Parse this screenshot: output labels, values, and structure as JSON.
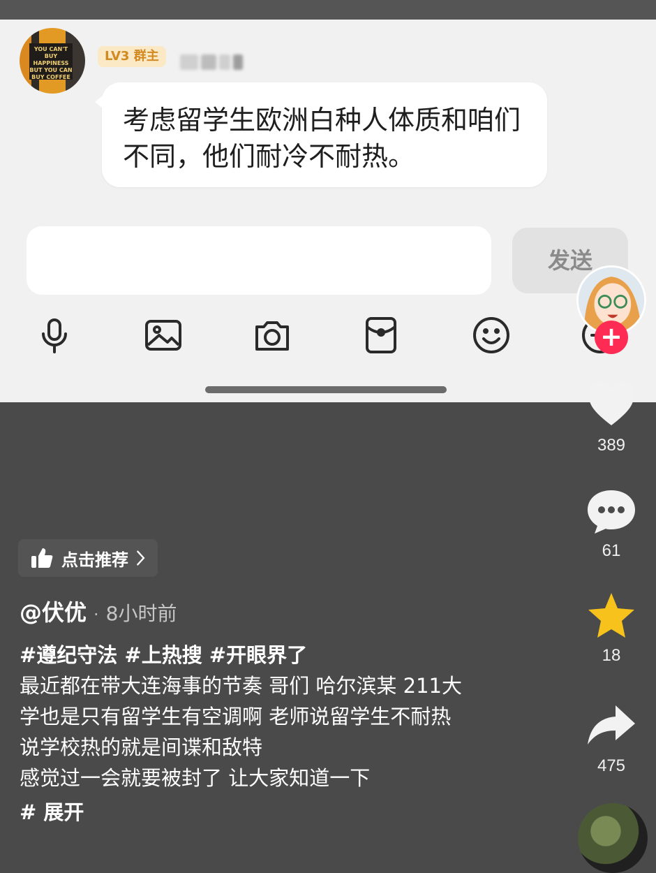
{
  "chat": {
    "badge": "LV3 群主",
    "message": "考虑留学生欧洲白种人体质和咱们不同，他们耐冷不耐热。",
    "send_label": "发送",
    "avatar_text": "YOU CAN'T BUY HAPPINESS BUT YOU CAN BUY COFFEE",
    "tools": [
      "microphone-icon",
      "image-icon",
      "camera-icon",
      "red-packet-icon",
      "emoji-icon",
      "plus-icon"
    ]
  },
  "actions": {
    "likes": "389",
    "comments": "61",
    "favorites": "18",
    "shares": "475"
  },
  "post": {
    "recommend": "点击推荐",
    "author": "@伏优",
    "separator": "·",
    "time": "8小时前",
    "tags": "#遵纪守法 #上热搜 #开眼界了",
    "lines": [
      "最近都在带大连海事的节奏 哥们 哈尔滨某 211大",
      "学也是只有留学生有空调啊 老师说留学生不耐热",
      "说学校热的就是间谍和敌特",
      "感觉过一会就要被封了 让大家知道一下"
    ],
    "expand": "# 展开"
  }
}
